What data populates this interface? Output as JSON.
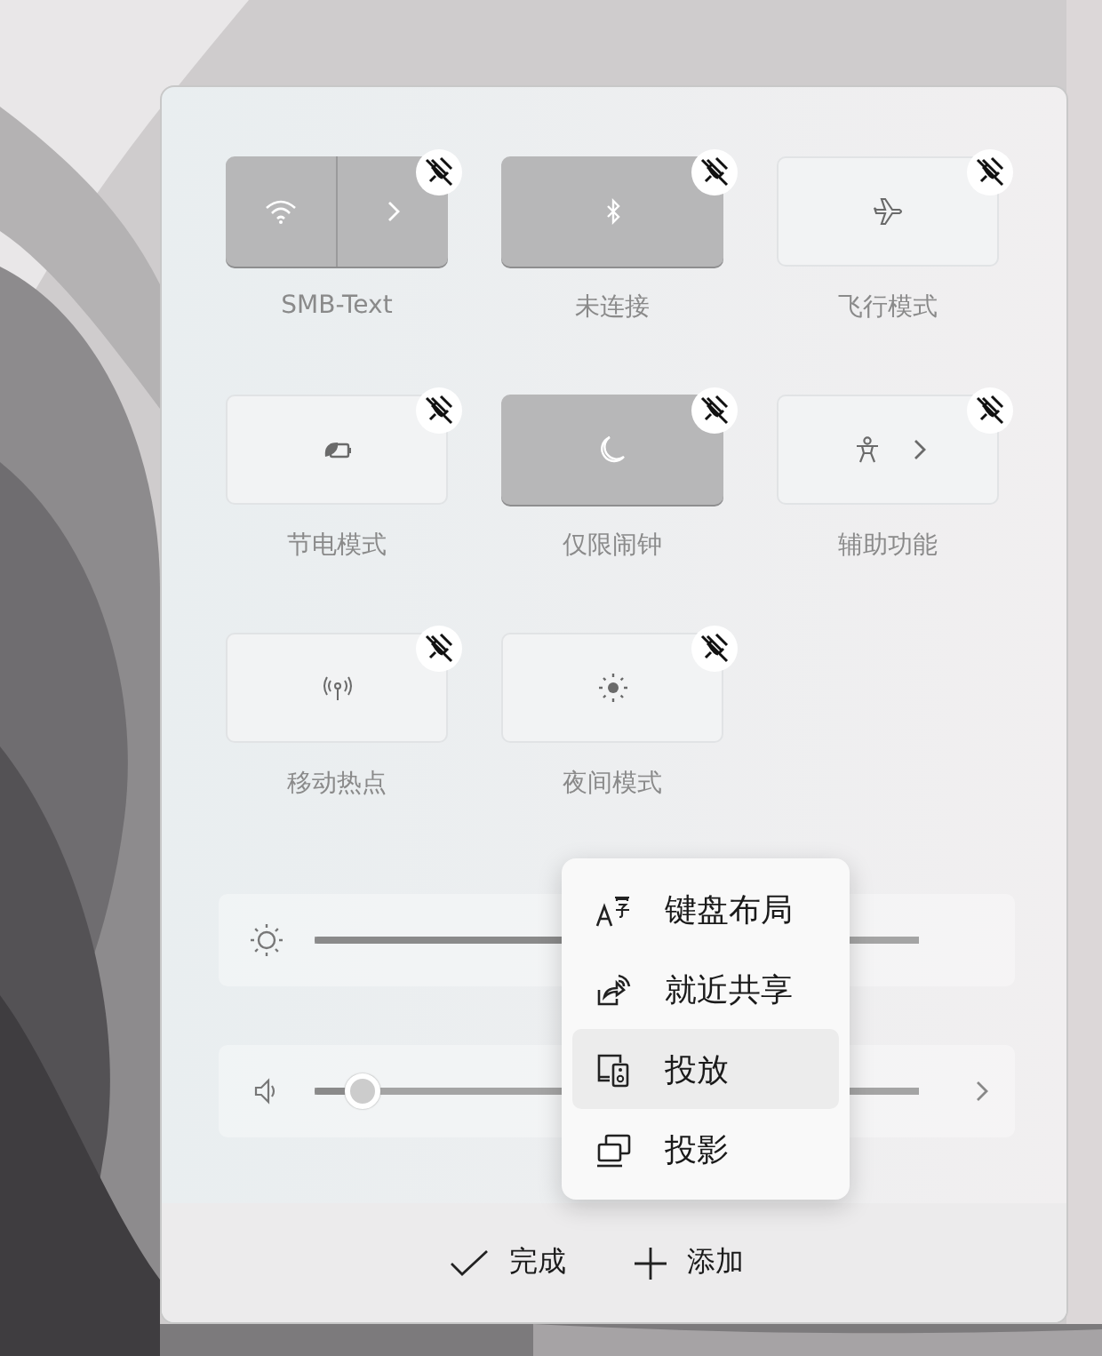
{
  "tiles": [
    {
      "label": "SMB-Text",
      "on": true,
      "kind": "split"
    },
    {
      "label": "未连接",
      "on": true,
      "kind": "plain"
    },
    {
      "label": "飞行模式",
      "on": false,
      "kind": "plain"
    },
    {
      "label": "节电模式",
      "on": false,
      "kind": "plain"
    },
    {
      "label": "仅限闹钟",
      "on": true,
      "kind": "plain"
    },
    {
      "label": "辅助功能",
      "on": false,
      "kind": "arrow"
    },
    {
      "label": "移动热点",
      "on": false,
      "kind": "plain"
    },
    {
      "label": "夜间模式",
      "on": false,
      "kind": "plain"
    }
  ],
  "sliders": [
    {
      "kind": "brightness",
      "level": 0.6
    },
    {
      "kind": "volume",
      "level": 0.08
    }
  ],
  "add_menu": {
    "items": [
      {
        "label": "键盘布局",
        "selected": false
      },
      {
        "label": "就近共享",
        "selected": false
      },
      {
        "label": "投放",
        "selected": true
      },
      {
        "label": "投影",
        "selected": false
      }
    ]
  },
  "footer": {
    "buttons": [
      {
        "label": "完成",
        "kind": "done"
      },
      {
        "label": "添加",
        "kind": "add"
      }
    ]
  }
}
